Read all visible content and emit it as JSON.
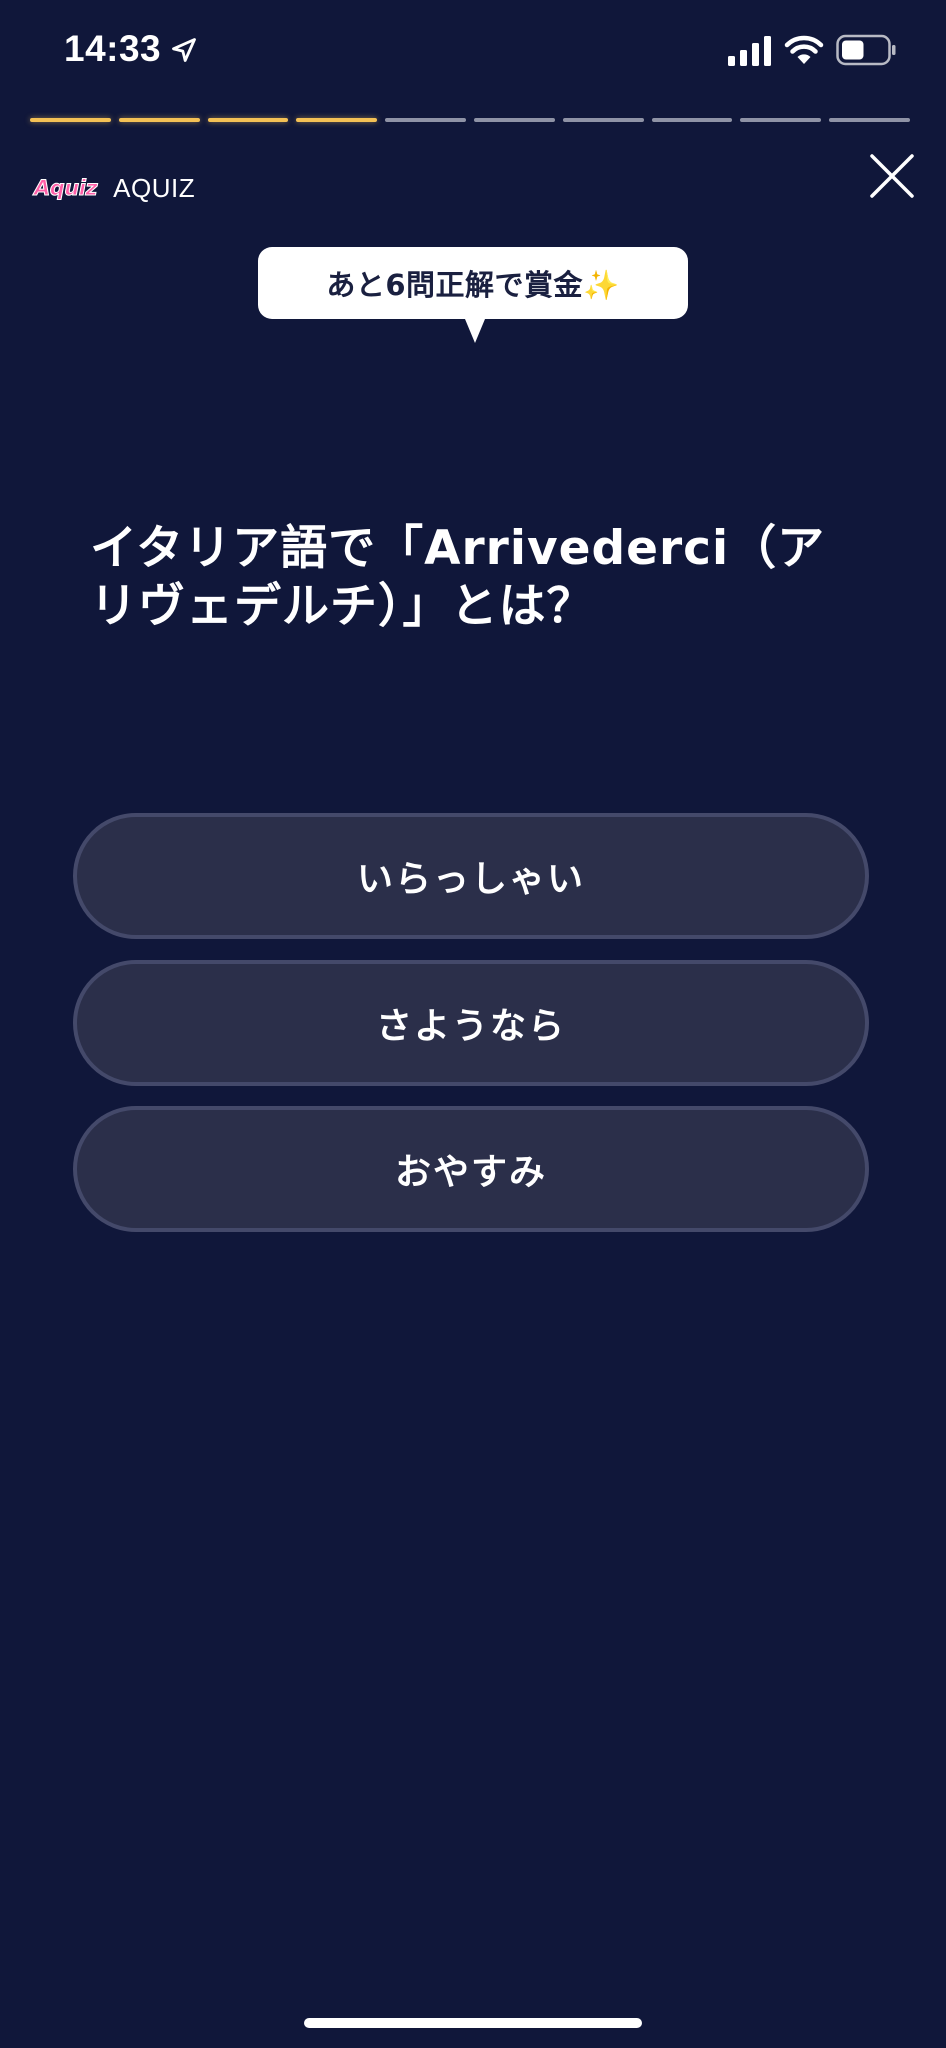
{
  "status_bar": {
    "time": "14:33",
    "icons": [
      "location-arrow-icon",
      "cellular-signal-icon",
      "wifi-icon",
      "battery-icon"
    ],
    "battery_level": 0.5
  },
  "progress": {
    "total": 10,
    "completed": 4,
    "done_color": "#f4c155",
    "pending_color": "#8f93a6"
  },
  "brand": {
    "logo_text": "Aquiz",
    "name": "AQUIZ"
  },
  "hint_bubble": {
    "text": "あと6問正解で賞金✨"
  },
  "question": {
    "text": "イタリア語で「Arrivederci（アリヴェデルチ）」とは？"
  },
  "answers": [
    {
      "label": "いらっしゃい"
    },
    {
      "label": "さようなら"
    },
    {
      "label": "おやすみ"
    }
  ],
  "colors": {
    "background": "#10173a",
    "answer_fill": "#2b2f4a",
    "answer_border": "#44496a",
    "accent": "#f4c155"
  }
}
